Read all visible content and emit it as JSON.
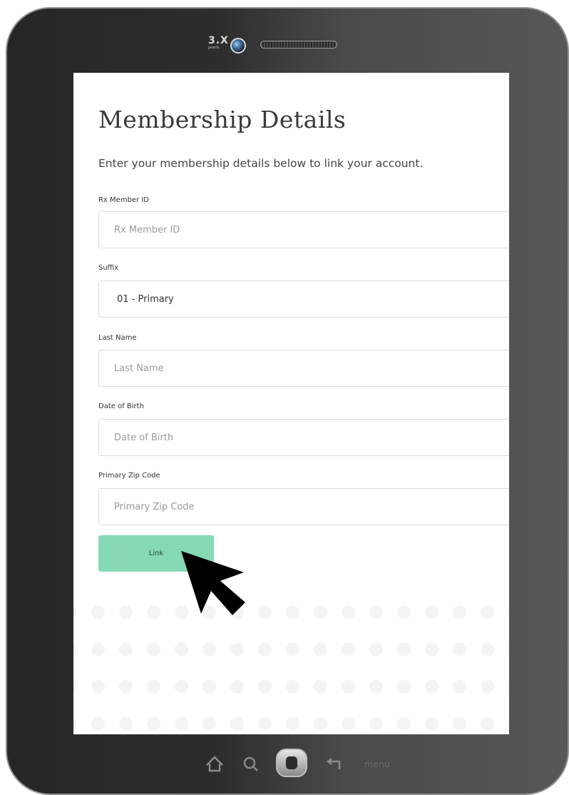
{
  "device": {
    "brand_main": "3.X",
    "brand_sub": "pearls",
    "nav": {
      "home_icon": "home-icon",
      "search_icon": "search-icon",
      "back_icon": "back-icon",
      "menu_label": "menu"
    }
  },
  "form": {
    "title": "Membership Details",
    "subtitle": "Enter your membership details below to link your account.",
    "fields": [
      {
        "label": "Rx Member ID",
        "placeholder": "Rx Member ID",
        "value": ""
      },
      {
        "label": "Suffix",
        "value": "01 - Primary"
      },
      {
        "label": "Last Name",
        "placeholder": "Last Name",
        "value": ""
      },
      {
        "label": "Date of Birth",
        "placeholder": "Date of Birth",
        "value": ""
      },
      {
        "label": "Primary Zip Code",
        "placeholder": "Primary Zip Code",
        "value": ""
      }
    ],
    "submit_label": "Link"
  },
  "colors": {
    "button": "#85d9b4",
    "bezel": "#2d2d2d",
    "field_border": "#dcdcdc"
  }
}
